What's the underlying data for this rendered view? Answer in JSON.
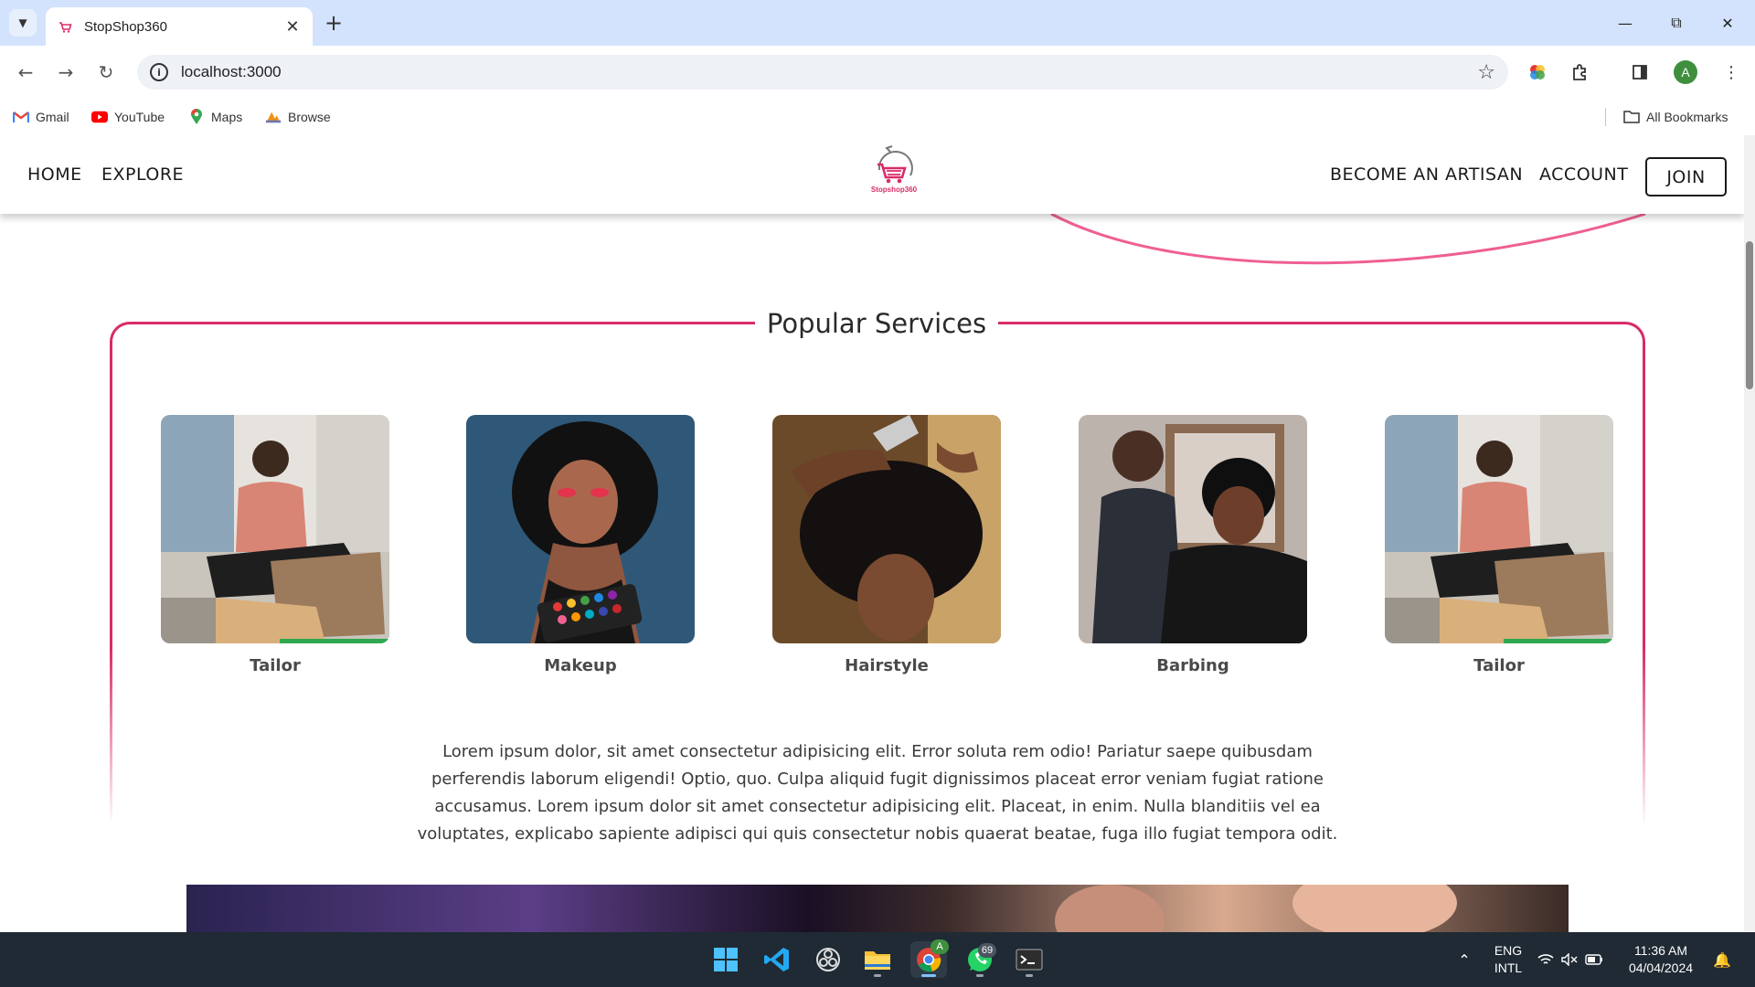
{
  "browser": {
    "tab": {
      "title": "StopShop360",
      "favicon": "stopshop-favicon"
    },
    "url": "localhost:3000",
    "bookmarks": [
      {
        "label": "Gmail",
        "icon": "gmail-icon"
      },
      {
        "label": "YouTube",
        "icon": "youtube-icon"
      },
      {
        "label": "Maps",
        "icon": "maps-icon"
      },
      {
        "label": "Browse",
        "icon": "pma-icon"
      }
    ],
    "all_bookmarks": "All Bookmarks",
    "profile_initial": "A"
  },
  "site": {
    "nav_left": [
      "HOME",
      "EXPLORE"
    ],
    "nav_right": [
      "BECOME AN ARTISAN",
      "ACCOUNT"
    ],
    "join_label": "JOIN",
    "logo_text": "Stopshop360",
    "brand_color": "#d92b6a"
  },
  "services": {
    "title": "Popular Services",
    "items": [
      {
        "label": "Tailor",
        "image": "tailor-photo"
      },
      {
        "label": "Makeup",
        "image": "makeup-photo"
      },
      {
        "label": "Hairstyle",
        "image": "hairstyle-photo"
      },
      {
        "label": "Barbing",
        "image": "barbing-photo"
      },
      {
        "label": "Tailor",
        "image": "tailor-photo"
      }
    ],
    "description": "Lorem ipsum dolor, sit amet consectetur adipisicing elit. Error soluta rem odio! Pariatur saepe quibusdam perferendis laborum eligendi! Optio, quo. Culpa aliquid fugit dignissimos placeat error veniam fugiat ratione accusamus. Lorem ipsum dolor sit amet consectetur adipisicing elit. Placeat, in enim. Nulla blanditiis vel ea voluptates, explicabo sapiente adipisci qui quis consectetur nobis quaerat beatae, fuga illo fugiat tempora odit."
  },
  "taskbar": {
    "whatsapp_badge": "69",
    "language": "ENG",
    "layout": "INTL",
    "time": "11:36 AM",
    "date": "04/04/2024",
    "chrome_badge": "A"
  }
}
